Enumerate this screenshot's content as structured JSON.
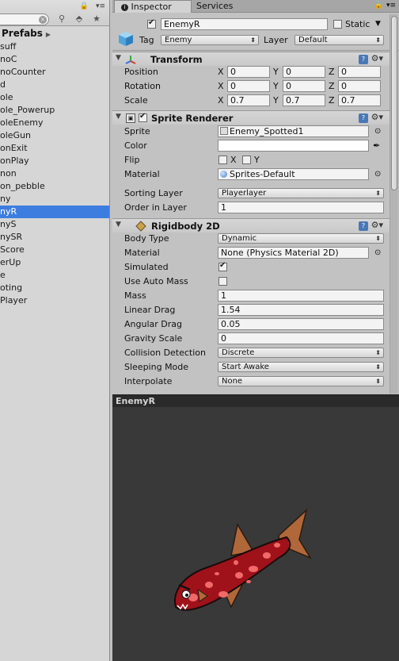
{
  "project": {
    "folder": "Prefabs",
    "items": [
      "suff",
      "noC",
      "noCounter",
      "d",
      "ole",
      "ole_Powerup",
      "oleEnemy",
      "oleGun",
      "onExit",
      "onPlay",
      "non",
      "on_pebble",
      "ny",
      "nyR",
      "nyS",
      "nySR",
      "Score",
      "erUp",
      "e",
      "oting",
      "Player"
    ],
    "selected_index": 13
  },
  "tabs": {
    "inspector": "Inspector",
    "services": "Services"
  },
  "object": {
    "name": "EnemyR",
    "static_label": "Static",
    "tag_label": "Tag",
    "tag_value": "Enemy",
    "layer_label": "Layer",
    "layer_value": "Default"
  },
  "transform": {
    "title": "Transform",
    "position_label": "Position",
    "rotation_label": "Rotation",
    "scale_label": "Scale",
    "axis_x": "X",
    "axis_y": "Y",
    "axis_z": "Z",
    "position": [
      "0",
      "0",
      "0"
    ],
    "rotation": [
      "0",
      "0",
      "0"
    ],
    "scale": [
      "0.7",
      "0.7",
      "0.7"
    ]
  },
  "sprite_renderer": {
    "title": "Sprite Renderer",
    "sprite_label": "Sprite",
    "sprite_value": "Enemy_Spotted1",
    "color_label": "Color",
    "flip_label": "Flip",
    "flip_x": "X",
    "flip_y": "Y",
    "material_label": "Material",
    "material_value": "Sprites-Default",
    "sorting_layer_label": "Sorting Layer",
    "sorting_layer_value": "Playerlayer",
    "order_label": "Order in Layer",
    "order_value": "1"
  },
  "rigidbody": {
    "title": "Rigidbody 2D",
    "body_type_label": "Body Type",
    "body_type_value": "Dynamic",
    "material_label": "Material",
    "material_value": "None (Physics Material 2D)",
    "simulated_label": "Simulated",
    "use_auto_mass_label": "Use Auto Mass",
    "mass_label": "Mass",
    "mass_value": "1",
    "linear_drag_label": "Linear Drag",
    "linear_drag_value": "1.54",
    "angular_drag_label": "Angular Drag",
    "angular_drag_value": "0.05",
    "gravity_label": "Gravity Scale",
    "gravity_value": "0",
    "collision_label": "Collision Detection",
    "collision_value": "Discrete",
    "sleeping_label": "Sleeping Mode",
    "sleeping_value": "Start Awake",
    "interpolate_label": "Interpolate",
    "interpolate_value": "None"
  },
  "preview": {
    "title": "EnemyR"
  },
  "colors": {
    "selection": "#3e7de0",
    "fish_body": "#a0121a",
    "fish_spots": "#f06a6a",
    "fish_fins": "#b0683a"
  }
}
